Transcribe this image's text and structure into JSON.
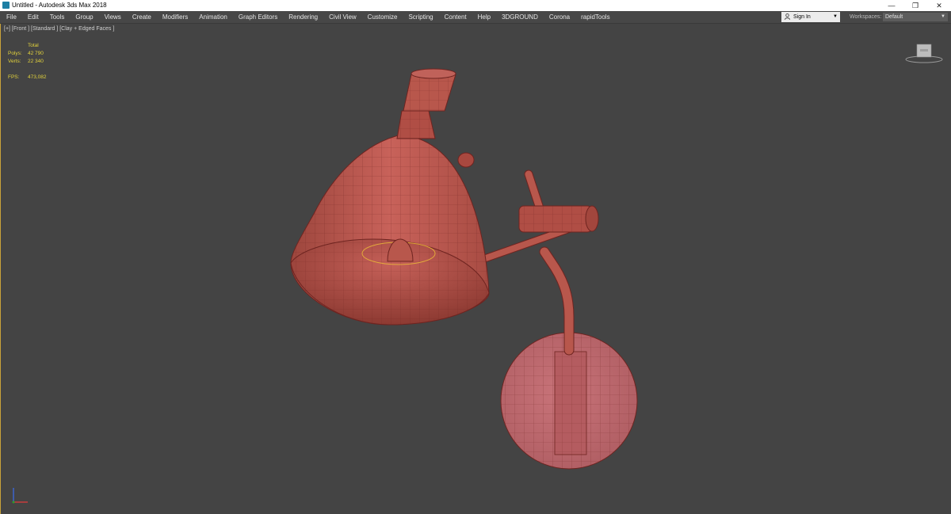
{
  "window": {
    "title": "Untitled - Autodesk 3ds Max 2018",
    "controls": [
      "—",
      "❐",
      "✕"
    ]
  },
  "menubar": {
    "items": [
      "File",
      "Edit",
      "Tools",
      "Group",
      "Views",
      "Create",
      "Modifiers",
      "Animation",
      "Graph Editors",
      "Rendering",
      "Civil View",
      "Customize",
      "Scripting",
      "Content",
      "Help",
      "3DGROUND",
      "Corona",
      "rapidTools"
    ],
    "signin_label": "Sign In",
    "workspaces_label": "Workspaces:",
    "workspaces_value": "Default"
  },
  "viewport": {
    "label": "[+] [Front ] [Standard ] [Clay + Edged Faces ]",
    "stats": {
      "header": "Total",
      "rows": [
        {
          "key": "Polys:",
          "value": "42 790"
        },
        {
          "key": "Verts:",
          "value": "22 340"
        },
        {
          "key": "FPS:",
          "value": "473,082"
        }
      ]
    },
    "model_color": "#b8574c",
    "wire_color": "#6e2420",
    "selection_color": "#e8b23a",
    "active_border_color": "#c9a33a"
  }
}
